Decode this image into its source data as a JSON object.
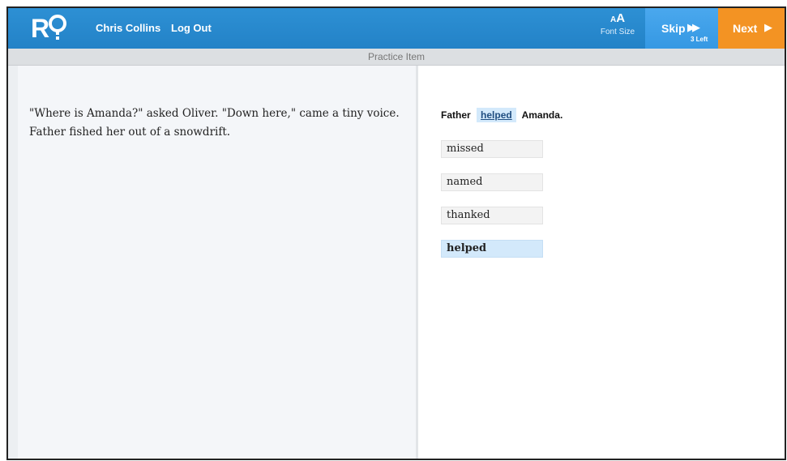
{
  "header": {
    "logo_text": "R?",
    "user_name": "Chris Collins",
    "logout_label": "Log Out",
    "font_size": {
      "glyph_small": "A",
      "glyph_large": "A",
      "label": "Font Size"
    },
    "skip": {
      "label": "Skip",
      "remaining": "3 Left"
    },
    "next": {
      "label": "Next"
    },
    "colors": {
      "header_blue": "#2382c7",
      "skip_blue": "#3598e3",
      "next_orange": "#f39323"
    }
  },
  "subheader": {
    "title": "Practice Item"
  },
  "passage": {
    "text": "\"Where is Amanda?\" asked Oliver. \"Down here,\" came a tiny voice. Father fished her out of a snowdrift."
  },
  "question": {
    "before": "Father",
    "blank": "helped",
    "after": "Amanda."
  },
  "options": [
    {
      "label": "missed",
      "selected": false
    },
    {
      "label": "named",
      "selected": false
    },
    {
      "label": "thanked",
      "selected": false
    },
    {
      "label": "helped",
      "selected": true
    }
  ]
}
